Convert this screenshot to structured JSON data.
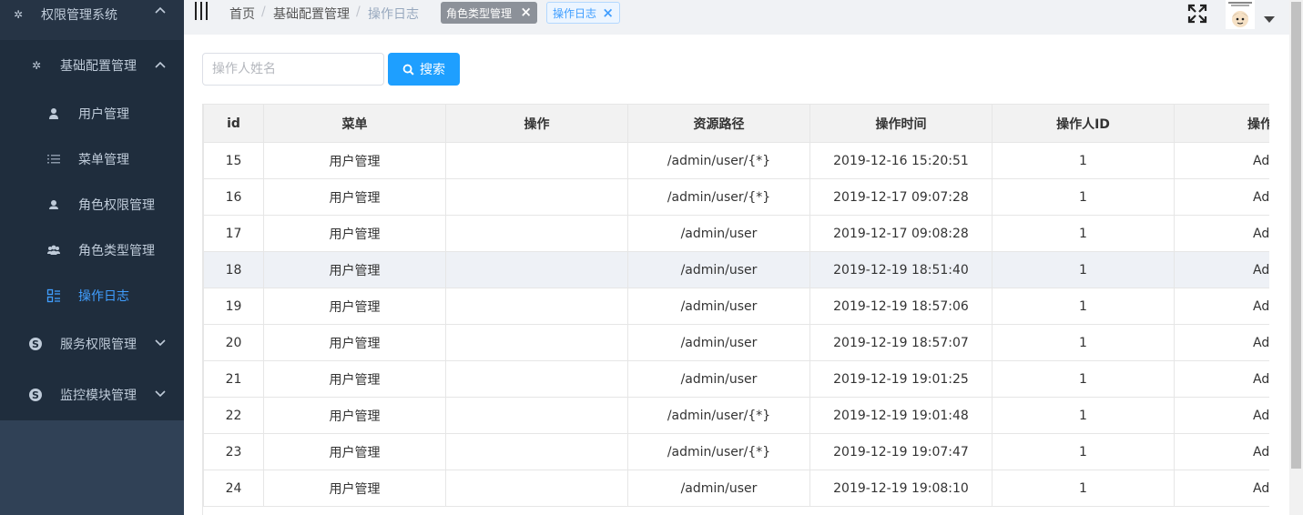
{
  "sidebar": {
    "title": "权限管理系统",
    "group": "基础配置管理",
    "items": [
      {
        "label": "用户管理",
        "icon": "user-icon"
      },
      {
        "label": "菜单管理",
        "icon": "list-icon"
      },
      {
        "label": "角色权限管理",
        "icon": "role-icon"
      },
      {
        "label": "角色类型管理",
        "icon": "users-icon"
      },
      {
        "label": "操作日志",
        "icon": "log-icon"
      }
    ],
    "groups_collapsed": [
      "服务权限管理",
      "监控模块管理"
    ],
    "active_color": "#409eff",
    "bg_color": "#304156"
  },
  "navbar": {
    "breadcrumb": [
      "首页",
      "基础配置管理",
      "操作日志"
    ],
    "tags": [
      "角色类型管理",
      "操作日志"
    ]
  },
  "search": {
    "placeholder": "操作人姓名",
    "button_label": "搜索",
    "button_color": "#1e9fff"
  },
  "table": {
    "headers": [
      "id",
      "菜单",
      "操作",
      "资源路径",
      "操作时间",
      "操作人ID",
      "操作"
    ],
    "rows": [
      [
        "15",
        "用户管理",
        "",
        "/admin/user/{*}",
        "2019-12-16 15:20:51",
        "1",
        "Ad"
      ],
      [
        "16",
        "用户管理",
        "",
        "/admin/user/{*}",
        "2019-12-17 09:07:28",
        "1",
        "Ad"
      ],
      [
        "17",
        "用户管理",
        "",
        "/admin/user",
        "2019-12-17 09:08:28",
        "1",
        "Ad"
      ],
      [
        "18",
        "用户管理",
        "",
        "/admin/user",
        "2019-12-19 18:51:40",
        "1",
        "Ad"
      ],
      [
        "19",
        "用户管理",
        "",
        "/admin/user",
        "2019-12-19 18:57:06",
        "1",
        "Ad"
      ],
      [
        "20",
        "用户管理",
        "",
        "/admin/user",
        "2019-12-19 18:57:07",
        "1",
        "Ad"
      ],
      [
        "21",
        "用户管理",
        "",
        "/admin/user",
        "2019-12-19 19:01:25",
        "1",
        "Ad"
      ],
      [
        "22",
        "用户管理",
        "",
        "/admin/user/{*}",
        "2019-12-19 19:01:48",
        "1",
        "Ad"
      ],
      [
        "23",
        "用户管理",
        "",
        "/admin/user/{*}",
        "2019-12-19 19:07:47",
        "1",
        "Ad"
      ],
      [
        "24",
        "用户管理",
        "",
        "/admin/user",
        "2019-12-19 19:08:10",
        "1",
        "Ad"
      ]
    ]
  }
}
